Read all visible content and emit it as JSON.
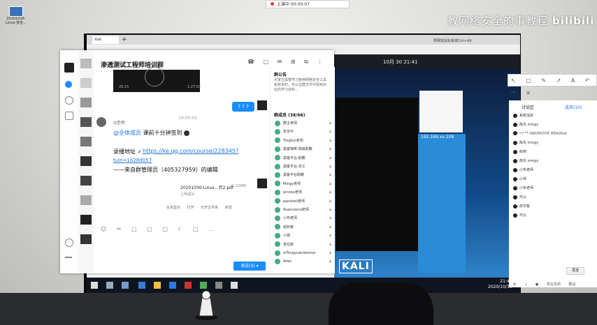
{
  "desktop": {
    "icon_label": "20201026-Linux-安全..."
  },
  "timer": {
    "text": "上课中 00:00:07"
  },
  "watermark": {
    "text": "教网络安全的事教程",
    "brand": "bilibili"
  },
  "vm": {
    "tab_label": "Kali",
    "plus": "+",
    "status": "要释放鼠标系按Ctrl+Alt",
    "kali_date": "10月 30  21:41",
    "kali_ip": "192.168.xx.108",
    "kali_logo": "KALI"
  },
  "taskbar": {
    "clock_time": "21:47",
    "clock_date": "2020/10/30"
  },
  "qq": {
    "title": "渗透测试工程师培训群",
    "title_icon": "✎",
    "top_icons": "☎ □ ✉ ⊞ ⧉ ⋮",
    "video_left": "20:15",
    "video_right": "1:27:03",
    "my_bubble": "? ? ?",
    "msg_time": "19:50:02",
    "sender": "Q老师",
    "msg_at": "@全体成员",
    "msg_text": " 课前十分钟签到 ",
    "msg_link_label": "录播地址 ✓",
    "msg_link": "https://ke.qq.com/course/228345?",
    "msg_link2": "tuin=1b28d057",
    "msg_footer": "——来自群管理员（405327959）的编辑",
    "file_name": "20201030-Linux...完2.pdf",
    "file_size": "(1.32MB)",
    "file_sub": "上传成功",
    "file_actions": "在全显示  打开  打开文件夹  转发",
    "tools": "☺ ✂ □ □ □ ☾ □ …",
    "send_label": "发送(S) ▾",
    "notice_title": "群公告",
    "notice_body": "大家在需要学习各种网络安全工具和技术时，可以在群文件中找到对应的学习资料...",
    "members_title": "群成员 (38/66)",
    "members": [
      "群主老师",
      "安全中",
      "Tingfun老师",
      "黑客咖啡-高级助教",
      "黑客平台-助教",
      "黑客平台-法工",
      "黑客平台助教",
      "Mingy老师",
      "pinney老师",
      "panshell老师",
      "Nuanvasra老师",
      "小布老师",
      "组织者",
      "小胡",
      "普拉斯",
      "xiTongyuanliesmar",
      "Alien"
    ]
  },
  "side": {
    "toolbar": "↖ □ ✎ ↗ A ↶ ↷ ✕",
    "tab_discuss": "讨论区",
    "tab_members": "成员(10)",
    "messages": [
      "系统消息",
      "陈先 mingy",
      "~/ **  /opt/etc/init.d/backup",
      "陈先 mingy",
      "收到",
      "陈先 mingy",
      "小布老师",
      "小师",
      "小布老师",
      "可以",
      "双日客",
      "可以"
    ],
    "button": "发送",
    "bottom": "⚙ ↓ ● 发言关闭 群设"
  }
}
